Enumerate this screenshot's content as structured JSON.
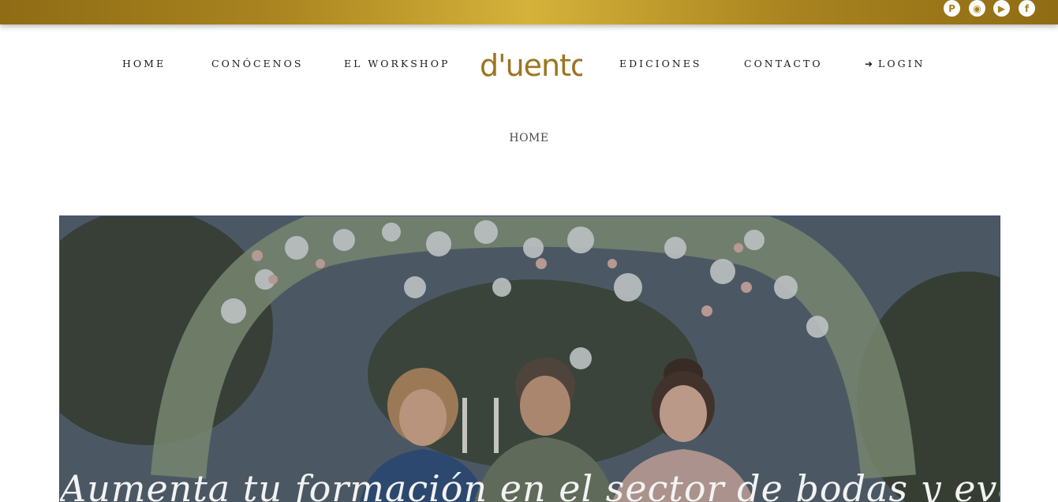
{
  "social": {
    "pinterest": "pinterest-icon",
    "instagram": "instagram-icon",
    "youtube": "youtube-icon",
    "facebook": "facebook-icon"
  },
  "nav": {
    "items": [
      {
        "label": "HOME"
      },
      {
        "label": "CONÓCENOS"
      },
      {
        "label": "EL WORKSHOP"
      },
      {
        "label": "EDICIONES"
      },
      {
        "label": "CONTACTO"
      },
      {
        "label": "LOGIN"
      }
    ],
    "logo": "d'uento",
    "login_icon": "sign-in-icon"
  },
  "breadcrumb": {
    "current": "HOME"
  },
  "hero": {
    "headline": "Aumenta tu formación en el sector de bodas y eventos"
  },
  "colors": {
    "gold": "#a8831f",
    "gold_light": "#d5b23a",
    "hero_border": "#3b4d88"
  }
}
